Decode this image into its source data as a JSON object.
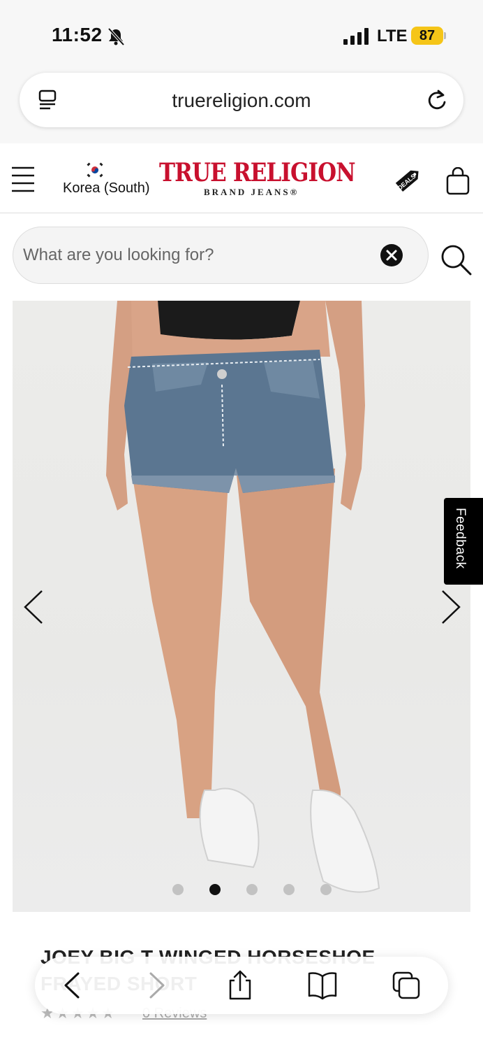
{
  "status_bar": {
    "time": "11:52",
    "network": "LTE",
    "battery": "87"
  },
  "browser": {
    "url": "truereligion.com"
  },
  "header": {
    "region": "Korea (South)",
    "logo_main": "TRUE RELIGION",
    "logo_sub": "BRAND JEANS®",
    "deals_badge": "DEALS"
  },
  "search": {
    "placeholder": "What are you looking for?"
  },
  "gallery": {
    "slide_count": 5,
    "active_slide": 2
  },
  "feedback": {
    "label": "Feedback"
  },
  "product": {
    "title": "JOEY BIG T WINGED HORSESHOE FRAYED SHORT",
    "rating_stars": "★★★★★",
    "reviews": "0 Reviews"
  },
  "colors": {
    "brand_red": "#c8102e",
    "battery_yellow": "#f5c518"
  }
}
